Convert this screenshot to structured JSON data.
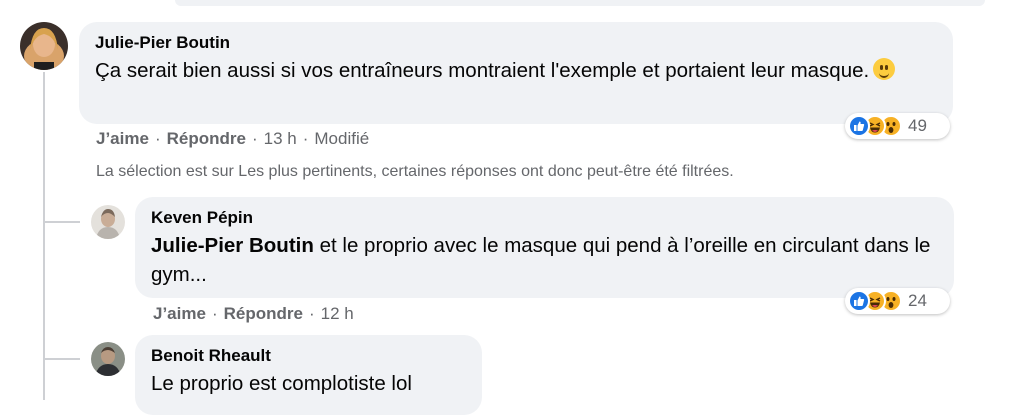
{
  "comments": [
    {
      "author": "Julie-Pier Boutin",
      "text": "Ça serait bien aussi si vos entraîneurs montraient l'exemple et portaient leur masque.",
      "emoji": "smiley-emoji",
      "like_label": "J’aime",
      "reply_label": "Répondre",
      "time": "13 h",
      "edited": "Modifié",
      "reaction_icons": [
        "like-reaction-icon",
        "haha-reaction-icon",
        "wow-reaction-icon"
      ],
      "reaction_count": "49"
    }
  ],
  "filter_note": "La sélection est sur Les plus pertinents, certaines réponses ont donc peut-être été filtrées.",
  "replies": [
    {
      "author": "Keven Pépin",
      "mention": "Julie-Pier Boutin",
      "text": "et le proprio avec le masque qui pend à l’oreille en circulant dans le gym...",
      "like_label": "J’aime",
      "reply_label": "Répondre",
      "time": "12 h",
      "reaction_icons": [
        "like-reaction-icon",
        "haha-reaction-icon",
        "wow-reaction-icon"
      ],
      "reaction_count": "24"
    },
    {
      "author": "Benoit Rheault",
      "text": "Le proprio est complotiste lol"
    }
  ],
  "separator": "·",
  "colors": {
    "bubble": "#f0f2f5",
    "meta_text": "#65676b",
    "like_blue": "#1b74e4",
    "reaction_yellow": "#f7b125",
    "thread_line": "#ced0d4"
  }
}
